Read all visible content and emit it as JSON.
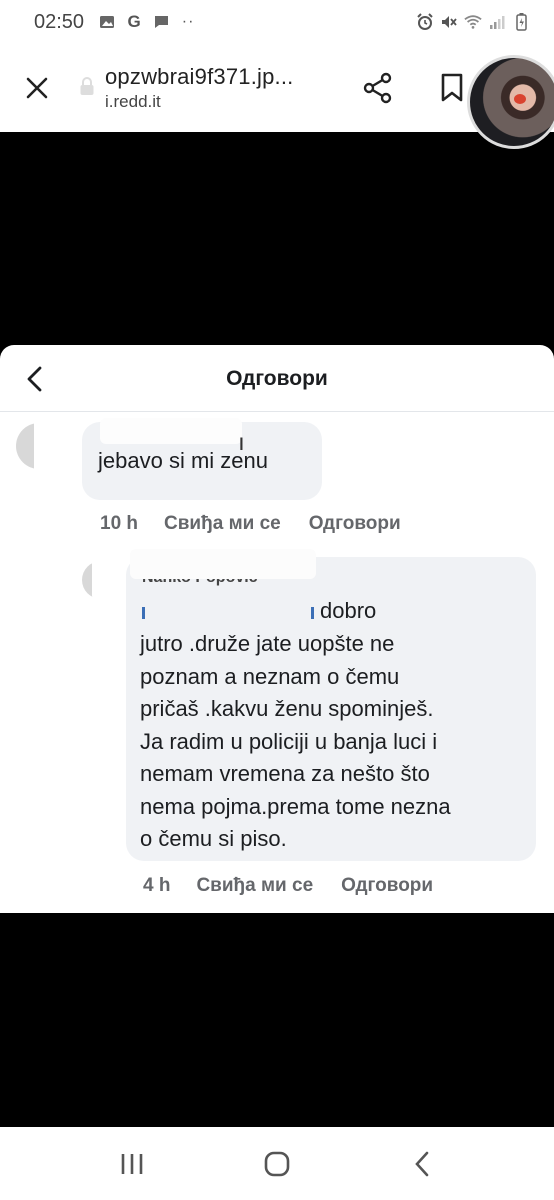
{
  "status_bar": {
    "time": "02:50",
    "left_icons": [
      "image-icon",
      "google-icon",
      "chat-icon",
      "more-dots-icon"
    ],
    "right_icons": [
      "alarm-icon",
      "mute-icon",
      "wifi-icon",
      "signal-icon",
      "battery-icon"
    ]
  },
  "browser": {
    "page_title": "opzwbrai9f371.jp...",
    "host": "i.redd.it",
    "icons": [
      "close-icon",
      "lock-icon",
      "share-icon",
      "bookmark-icon"
    ]
  },
  "panel": {
    "title": "Одговори",
    "comments": [
      {
        "name_fragment": "ן",
        "text": "jebavo si mi zenu",
        "time": "10 h",
        "like_label": "Свиђа ми се",
        "reply_label": "Одговори"
      },
      {
        "name_fragment": "Nanko Popovic",
        "text_first": "dobro",
        "text": "jutro .druže jate uopšte ne\npoznam a neznam o čemu\npričaš .kakvu ženu spominješ.\nJa radim u policiji u banja luci i\nnemam vremena za nešto što\nnema pojma.prema tome nezna\no čemu si piso.",
        "time": "4 h",
        "like_label": "Свиђа ми се",
        "reply_label": "Одговори"
      }
    ]
  },
  "nav_bar": {
    "icons": [
      "recent-apps-icon",
      "home-icon",
      "back-icon"
    ]
  },
  "colors": {
    "bubble": "#f0f2f5",
    "meta_text": "#65676b",
    "background": "#000000"
  }
}
